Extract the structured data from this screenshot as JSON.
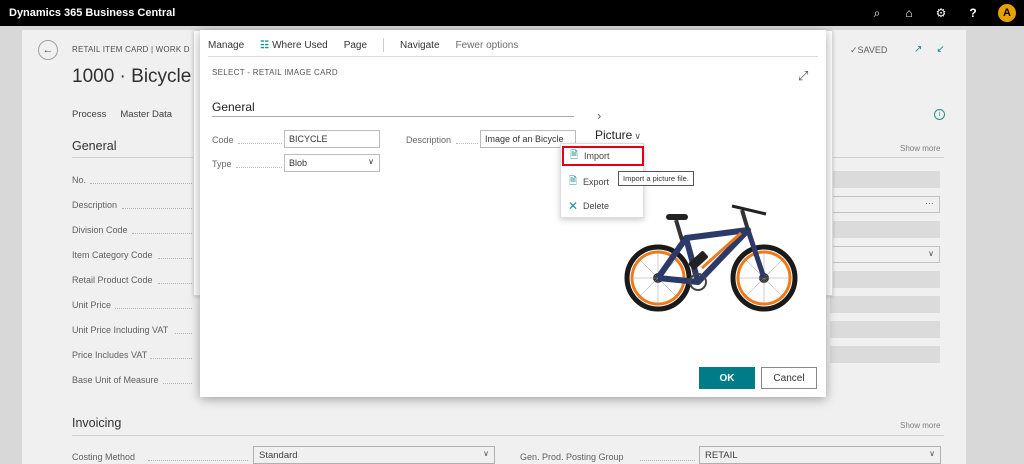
{
  "app_title": "Dynamics 365 Business Central",
  "topbar_icons": [
    "search-icon",
    "bell-icon",
    "gear-icon",
    "help-icon"
  ],
  "user_initial": "A",
  "bg": {
    "breadcrumb": "RETAIL ITEM CARD | WORK D",
    "title": "1000 · Bicycle",
    "actions": [
      "Process",
      "Master Data"
    ],
    "saved": "SAVED",
    "general_title": "General",
    "show_more": "Show more",
    "fields": [
      "No.",
      "Description",
      "Division Code",
      "Item Category Code",
      "Retail Product Code",
      "Unit Price",
      "Unit Price Including VAT",
      "Price Includes VAT",
      "Base Unit of Measure"
    ],
    "invoicing_title": "Invoicing",
    "invoicing_show_more": "Show more",
    "costing_label": "Costing Method",
    "costing_value": "Standard",
    "gen_prod_label": "Gen. Prod. Posting Group",
    "gen_prod_value": "RETAIL"
  },
  "dialog": {
    "menubar": {
      "manage": "Manage",
      "where_used": "Where Used",
      "page": "Page",
      "navigate": "Navigate",
      "fewer": "Fewer options"
    },
    "subtitle": "SELECT - RETAIL IMAGE CARD",
    "section": "General",
    "code_label": "Code",
    "code_value": "BICYCLE",
    "type_label": "Type",
    "type_value": "Blob",
    "desc_label": "Description",
    "desc_value": "Image of an Bicycle",
    "picture_title": "Picture",
    "menu": {
      "import": "Import",
      "export": "Export",
      "delete": "Delete"
    },
    "tooltip": "Import a picture file.",
    "ok": "OK",
    "cancel": "Cancel"
  },
  "colors": {
    "accent": "#007c89",
    "highlight": "#e0001b",
    "topbar": "#000000"
  }
}
